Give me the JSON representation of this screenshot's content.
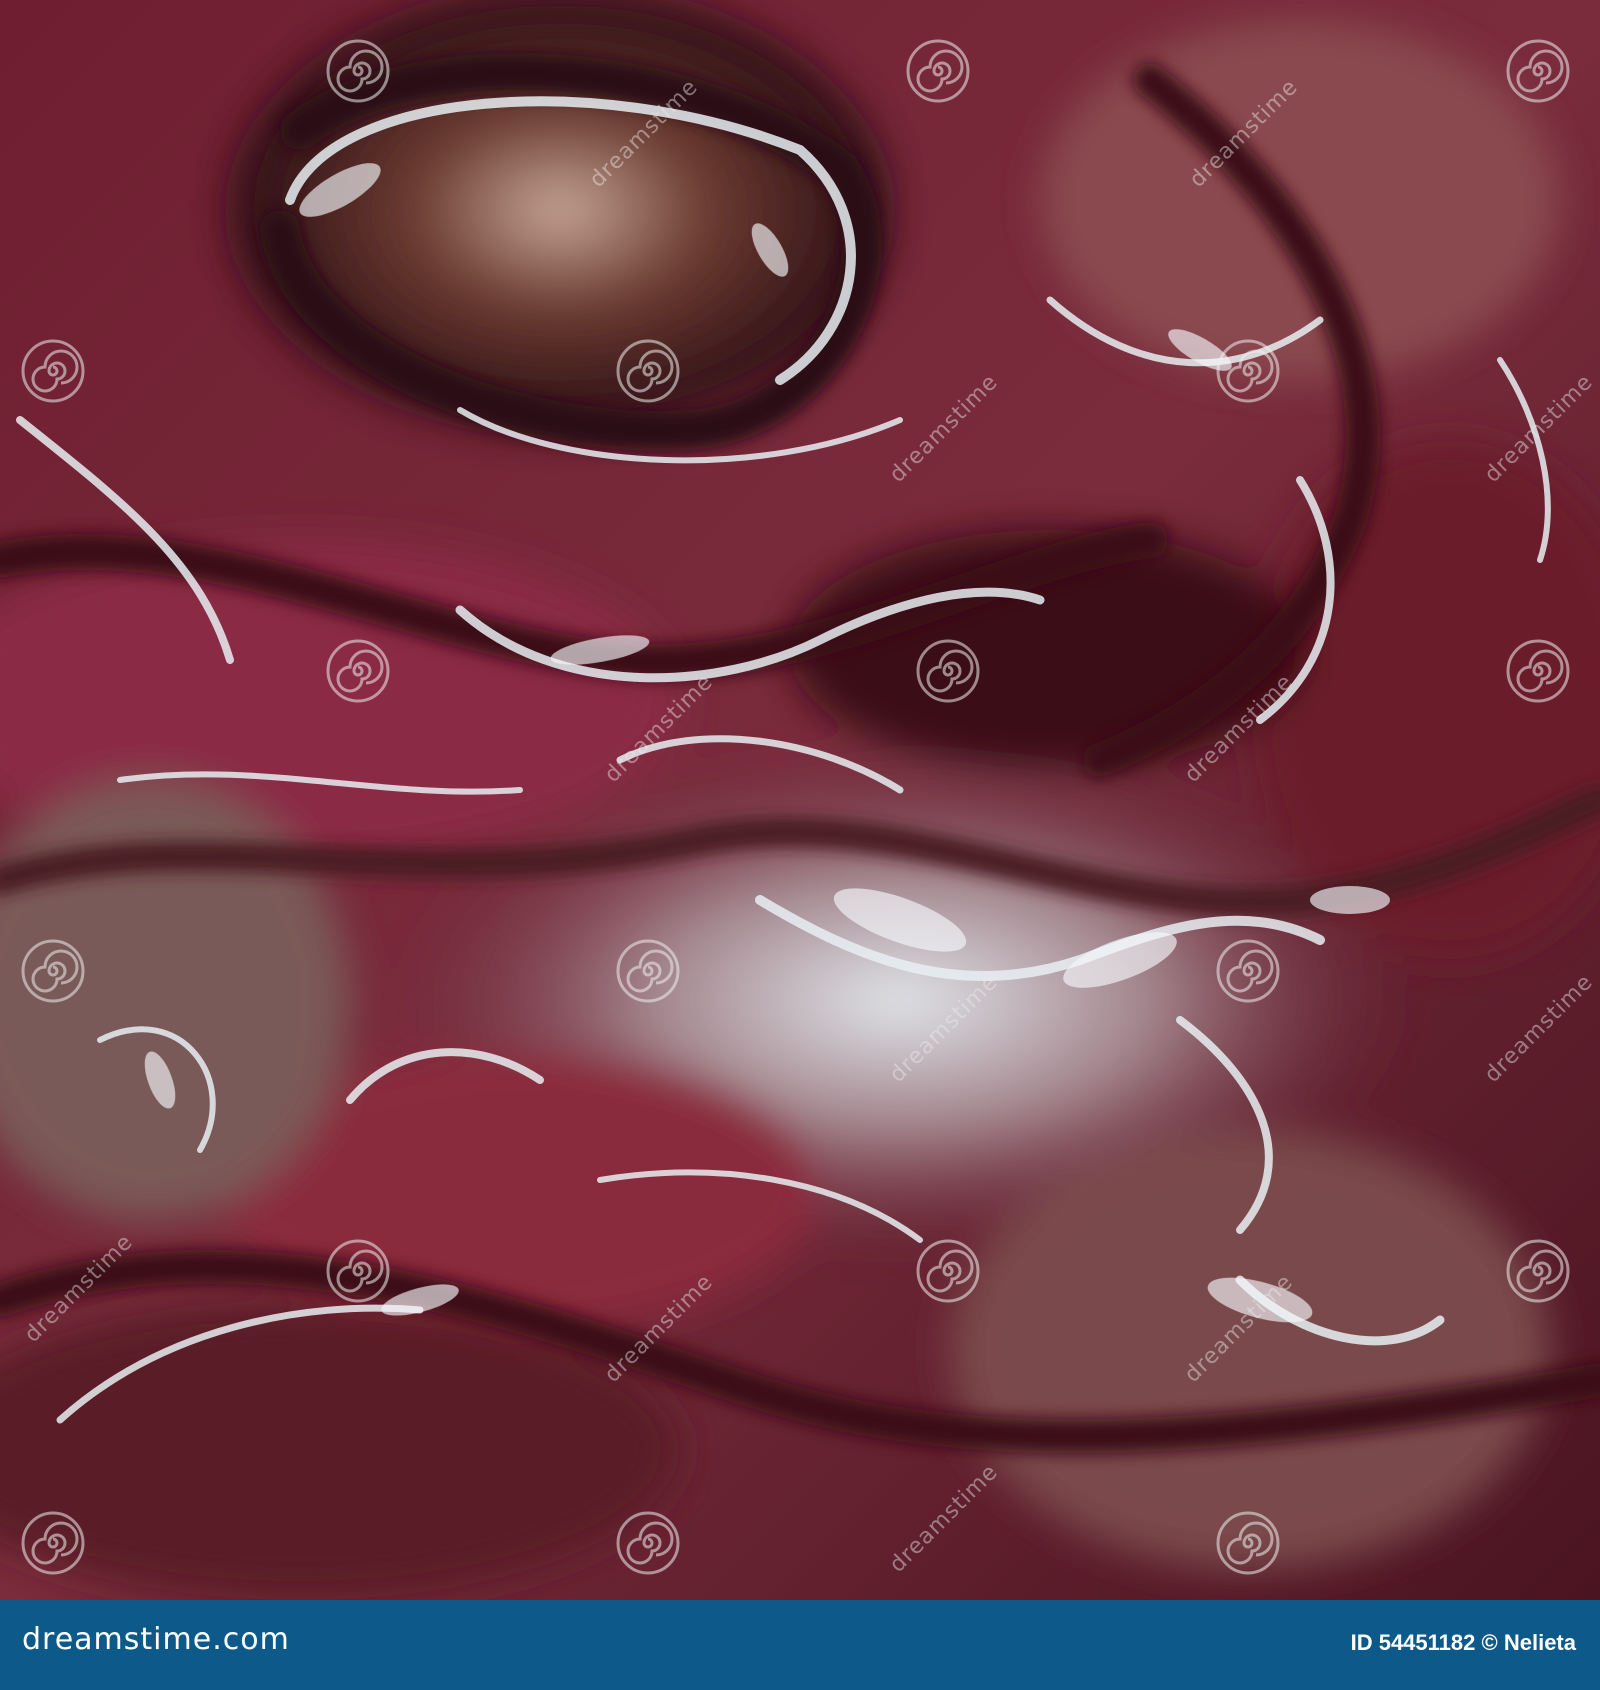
{
  "image": {
    "subject": "glossy organic texture",
    "colors": {
      "base": "#6a1a2c",
      "dark": "#2a0c14",
      "mid": "#8a3a4c",
      "light": "#c89aa0",
      "highlight": "#e8eef2",
      "brown": "#5a3a30"
    }
  },
  "watermark": {
    "text": "dreamstime",
    "logo_icon": "spiral-icon"
  },
  "footer": {
    "site": "dreamstime.com",
    "id_label": "ID",
    "id_value": "54451182",
    "copyright_symbol": "©",
    "author": "Nelieta",
    "background": "#0d5a8a"
  }
}
